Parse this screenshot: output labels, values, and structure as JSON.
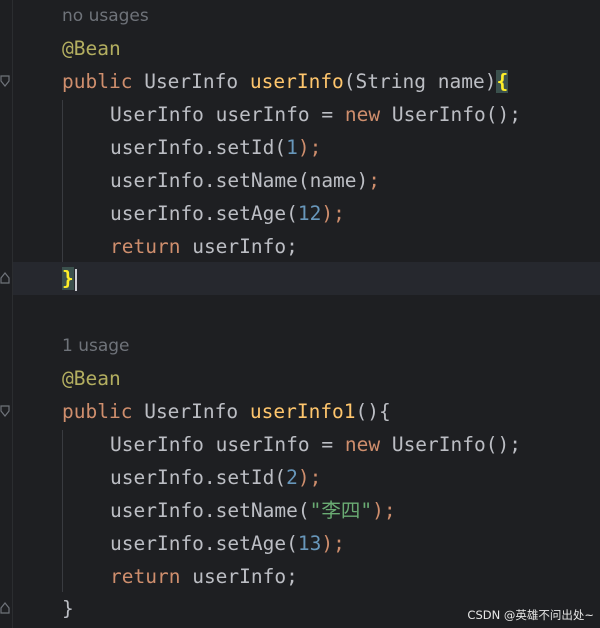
{
  "methods": [
    {
      "usage_hint": "no usages",
      "annotation": "@Bean",
      "signature": {
        "modifier": "public",
        "return_type": "UserInfo",
        "name": "userInfo",
        "open_paren": "(",
        "param_type": "String",
        "param_name": "name",
        "close_paren": ")",
        "open_brace": "{"
      },
      "body": {
        "decl_type": "UserInfo",
        "decl_var": "userInfo",
        "decl_eq": "=",
        "decl_new": "new",
        "decl_ctor": "UserInfo();",
        "set_id_call": "userInfo.setId(",
        "set_id_value": "1",
        "set_id_end": ");",
        "set_name_call": "userInfo.setName(name)",
        "set_name_end": ";",
        "set_age_call": "userInfo.setAge(",
        "set_age_value": "12",
        "set_age_end": ");",
        "return_kw": "return",
        "return_val": "userInfo;"
      },
      "close_brace": "}"
    },
    {
      "usage_hint": "1 usage",
      "annotation": "@Bean",
      "signature": {
        "modifier": "public",
        "return_type": "UserInfo",
        "name": "userInfo1",
        "parens_brace": "(){"
      },
      "body": {
        "decl_type": "UserInfo",
        "decl_var": "userInfo",
        "decl_eq": "=",
        "decl_new": "new",
        "decl_ctor": "UserInfo();",
        "set_id_call": "userInfo.setId(",
        "set_id_value": "2",
        "set_id_end": ");",
        "set_name_call": "userInfo.setName(",
        "set_name_value": "\"李四\"",
        "set_name_end": ");",
        "set_age_call": "userInfo.setAge(",
        "set_age_value": "13",
        "set_age_end": ");",
        "return_kw": "return",
        "return_val": "userInfo;"
      },
      "close_brace": "}"
    }
  ],
  "watermark": "CSDN @英雄不问出处~",
  "colors": {
    "background": "#1e1f22",
    "current_line": "#26282e",
    "annotation": "#b3ae60",
    "keyword": "#cf8e6d",
    "method_name": "#ffc66d",
    "number": "#6897bb",
    "string": "#6aab73",
    "text": "#bcbec4",
    "hint": "#6f737a",
    "brace_match_bg": "#3b514d",
    "brace_match_fg": "#ffef28"
  }
}
